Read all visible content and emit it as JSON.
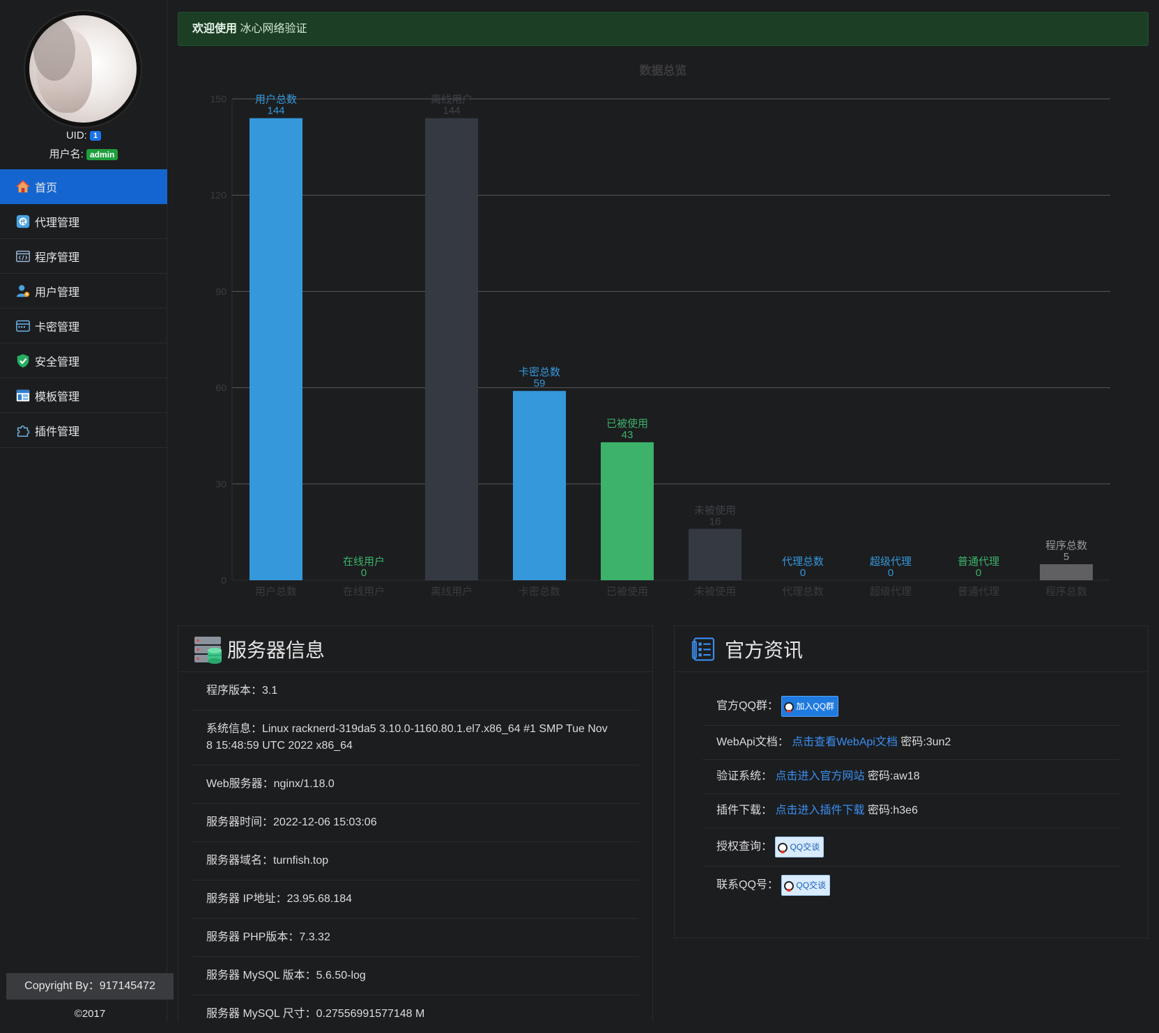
{
  "sidebar": {
    "uid_label": "UID:",
    "uid_value": "1",
    "username_label": "用户名:",
    "username_value": "admin",
    "items": [
      {
        "label": "首页",
        "icon": "home-icon"
      },
      {
        "label": "代理管理",
        "icon": "agent-icon"
      },
      {
        "label": "程序管理",
        "icon": "program-icon"
      },
      {
        "label": "用户管理",
        "icon": "user-icon"
      },
      {
        "label": "卡密管理",
        "icon": "card-icon"
      },
      {
        "label": "安全管理",
        "icon": "shield-icon"
      },
      {
        "label": "模板管理",
        "icon": "template-icon"
      },
      {
        "label": "插件管理",
        "icon": "plugin-icon"
      }
    ],
    "copyright": "Copyright By：917145472",
    "year": "©2017"
  },
  "welcome": {
    "strong": "欢迎使用",
    "text": "冰心网络验证"
  },
  "chart_data": {
    "type": "bar",
    "title": "数据总览",
    "categories": [
      "用户总数",
      "在线用户",
      "离线用户",
      "卡密总数",
      "已被使用",
      "未被使用",
      "代理总数",
      "超级代理",
      "普通代理",
      "程序总数"
    ],
    "values": [
      144,
      0,
      144,
      59,
      43,
      16,
      0,
      0,
      0,
      5
    ],
    "colors": [
      "#3498db",
      "#3cb26a",
      "#353a42",
      "#3498db",
      "#3cb26a",
      "#353a42",
      "#3498db",
      "#3498db",
      "#3cb26a",
      "#606062"
    ],
    "yticks": [
      0,
      30,
      60,
      90,
      120,
      150
    ],
    "ylim": [
      0,
      150
    ],
    "grid": true
  },
  "server": {
    "title": "服务器信息",
    "rows": [
      {
        "label": "程序版本：",
        "value": "3.1"
      },
      {
        "label": "系统信息：",
        "value": "Linux racknerd-319da5 3.10.0-1160.80.1.el7.x86_64 #1 SMP Tue Nov 8 15:48:59 UTC 2022 x86_64"
      },
      {
        "label": "Web服务器：",
        "value": "nginx/1.18.0"
      },
      {
        "label": "服务器时间：",
        "value": "2022-12-06 15:03:06"
      },
      {
        "label": "服务器域名：",
        "value": "turnfish.top"
      },
      {
        "label": "服务器 IP地址：",
        "value": "23.95.68.184"
      },
      {
        "label": "服务器 PHP版本：",
        "value": "7.3.32"
      },
      {
        "label": "服务器 MySQL 版本：",
        "value": "5.6.50-log"
      },
      {
        "label": "服务器 MySQL 尺寸：",
        "value": "0.27556991577148 M"
      }
    ]
  },
  "news": {
    "title": "官方资讯",
    "qq_group_label": "官方QQ群：",
    "qq_group_btn": "加入QQ群",
    "webapi_label": "WebApi文档：",
    "webapi_link": "点击查看WebApi文档",
    "webapi_pwd": "密码:3un2",
    "verify_label": "验证系统：",
    "verify_link": "点击进入官方网站",
    "verify_pwd": "密码:aw18",
    "plugin_label": "插件下载：",
    "plugin_link": "点击进入插件下载",
    "plugin_pwd": "密码:h3e6",
    "auth_label": "授权查询：",
    "auth_btn": "QQ交谈",
    "contact_label": "联系QQ号：",
    "contact_btn": "QQ交谈"
  }
}
